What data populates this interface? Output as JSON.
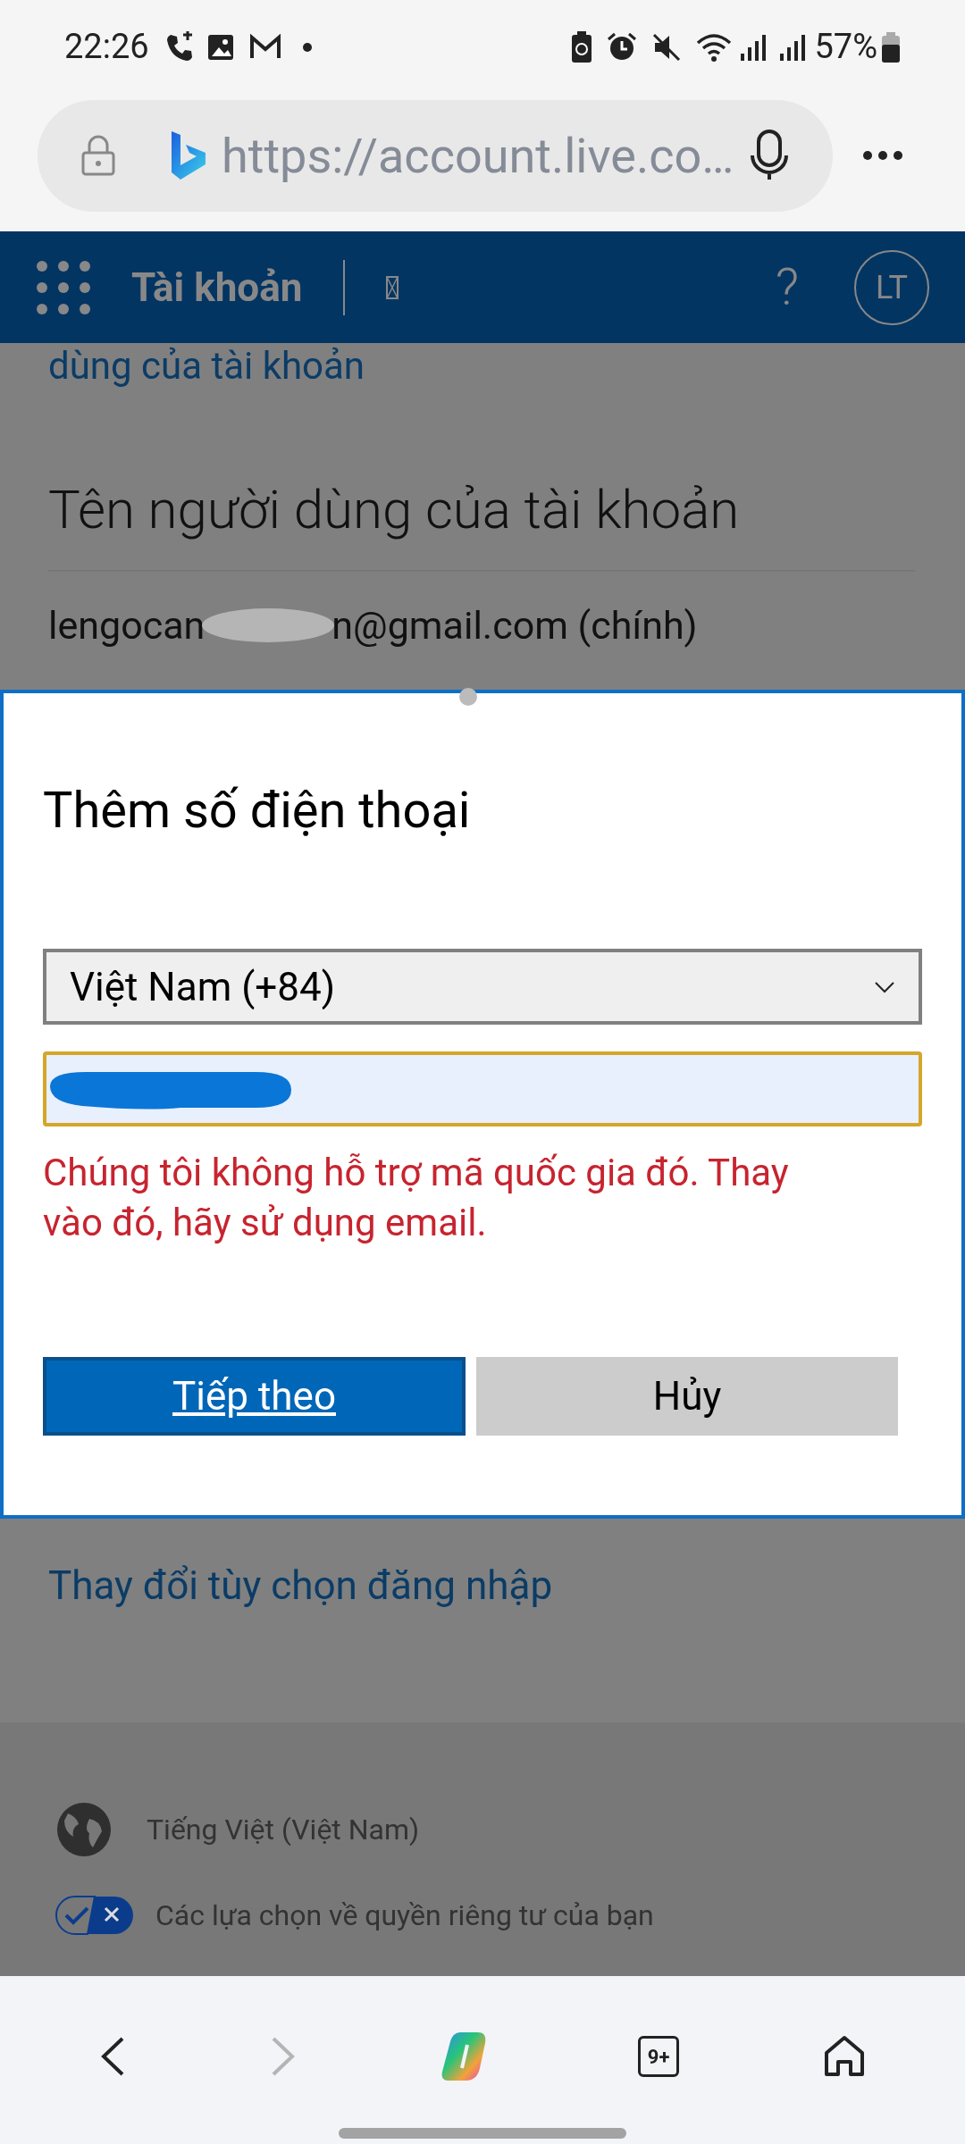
{
  "status_bar": {
    "time": "22:26",
    "battery": "57%"
  },
  "browser": {
    "url": "https://account.live.co…"
  },
  "site_header": {
    "title": "Tài khoản",
    "help": "?",
    "avatar": "LT"
  },
  "page": {
    "top_link": "dùng của tài khoản",
    "section_title": "Tên người dùng của tài khoản",
    "email_start": "lengocan",
    "email_end": "n@gmail.com (chính)",
    "bottom_link": "Thay đổi tùy chọn đăng nhập"
  },
  "dialog": {
    "title": "Thêm số điện thoại",
    "country": "Việt Nam (+84)",
    "error": "Chúng tôi không hỗ trợ mã quốc gia đó. Thay vào đó, hãy sử dụng email.",
    "buttons": [
      {
        "label": "Tiếp theo",
        "kind": "primary"
      },
      {
        "label": "Hủy",
        "kind": "secondary"
      }
    ]
  },
  "footer": {
    "language": "Tiếng Việt (Việt Nam)",
    "privacy": "Các lựa chọn về quyền riêng tư của bạn"
  },
  "nav": [
    {
      "kind": "back",
      "disabled": false
    },
    {
      "kind": "forward",
      "disabled": true
    },
    {
      "kind": "copilot",
      "disabled": false
    },
    {
      "kind": "tabs",
      "label": "9+",
      "disabled": false
    },
    {
      "kind": "home",
      "disabled": false
    }
  ]
}
